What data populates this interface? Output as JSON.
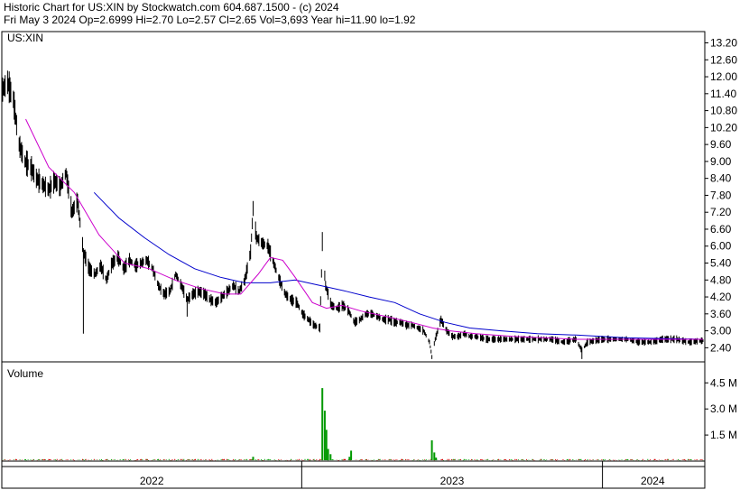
{
  "header": {
    "line1": "Historic Chart for US:XIN by Stockwatch.com 604.687.1500 - (c) 2024",
    "line2": "Fri May  3 2024   Op=2.6999  Hi=2.70  Lo=2.57  Cl=2.65  Vol=3,693  Year hi=11.90  lo=1.92"
  },
  "chart_data": {
    "type": "line",
    "ticker_label": "US:XIN",
    "volume_label": "Volume",
    "price_axis": {
      "ticks": [
        "13.20",
        "12.60",
        "12.00",
        "11.40",
        "10.80",
        "10.20",
        "9.60",
        "9.00",
        "8.40",
        "7.80",
        "7.20",
        "6.60",
        "6.00",
        "5.40",
        "4.80",
        "4.20",
        "3.60",
        "3.00",
        "2.40"
      ],
      "ylim": [
        1.9,
        13.6
      ]
    },
    "volume_axis": {
      "ticks": [
        "4.5 M",
        "3.0 M",
        "1.5 M"
      ],
      "ylim": [
        0,
        5500000
      ]
    },
    "x_axis": {
      "years": [
        "2022",
        "2023",
        "2024"
      ],
      "range": [
        "2022-01-03",
        "2024-05-03"
      ]
    },
    "colors": {
      "price": "#000000",
      "ma_short": "#cc00cc",
      "ma_long": "#0000cc",
      "vol_up": "#009900",
      "vol_down": "#cc0000"
    },
    "price_points": [
      [
        "2022-01-03",
        11.5
      ],
      [
        "2022-01-10",
        11.8
      ],
      [
        "2022-01-17",
        11.2
      ],
      [
        "2022-01-24",
        9.6
      ],
      [
        "2022-01-31",
        9.0
      ],
      [
        "2022-02-07",
        8.8
      ],
      [
        "2022-02-14",
        8.4
      ],
      [
        "2022-02-21",
        8.2
      ],
      [
        "2022-03-01",
        8.0
      ],
      [
        "2022-03-08",
        8.3
      ],
      [
        "2022-03-15",
        8.1
      ],
      [
        "2022-03-22",
        8.6
      ],
      [
        "2022-03-29",
        7.2
      ],
      [
        "2022-04-05",
        7.6
      ],
      [
        "2022-04-12",
        5.8
      ],
      [
        "2022-04-19",
        5.2
      ],
      [
        "2022-04-26",
        5.0
      ],
      [
        "2022-05-03",
        5.3
      ],
      [
        "2022-05-10",
        4.8
      ],
      [
        "2022-05-17",
        5.4
      ],
      [
        "2022-05-24",
        5.6
      ],
      [
        "2022-05-31",
        5.2
      ],
      [
        "2022-06-07",
        5.5
      ],
      [
        "2022-06-14",
        5.3
      ],
      [
        "2022-06-21",
        5.4
      ],
      [
        "2022-06-28",
        5.5
      ],
      [
        "2022-07-05",
        5.2
      ],
      [
        "2022-07-12",
        4.6
      ],
      [
        "2022-07-19",
        4.3
      ],
      [
        "2022-07-26",
        4.4
      ],
      [
        "2022-08-02",
        5.0
      ],
      [
        "2022-08-09",
        4.6
      ],
      [
        "2022-08-16",
        4.1
      ],
      [
        "2022-08-23",
        4.3
      ],
      [
        "2022-08-30",
        4.4
      ],
      [
        "2022-09-06",
        4.3
      ],
      [
        "2022-09-13",
        4.1
      ],
      [
        "2022-09-20",
        4.0
      ],
      [
        "2022-09-27",
        4.2
      ],
      [
        "2022-10-04",
        4.4
      ],
      [
        "2022-10-11",
        4.6
      ],
      [
        "2022-10-18",
        4.4
      ],
      [
        "2022-10-25",
        4.8
      ],
      [
        "2022-11-01",
        5.8
      ],
      [
        "2022-11-04",
        7.3
      ],
      [
        "2022-11-08",
        6.3
      ],
      [
        "2022-11-15",
        6.1
      ],
      [
        "2022-11-22",
        6.0
      ],
      [
        "2022-11-29",
        5.4
      ],
      [
        "2022-12-06",
        4.8
      ],
      [
        "2022-12-13",
        4.3
      ],
      [
        "2022-12-20",
        4.1
      ],
      [
        "2022-12-27",
        4.0
      ],
      [
        "2023-01-03",
        3.6
      ],
      [
        "2023-01-10",
        3.4
      ],
      [
        "2023-01-17",
        3.2
      ],
      [
        "2023-01-24",
        3.1
      ],
      [
        "2023-01-27",
        6.0
      ],
      [
        "2023-01-31",
        4.6
      ],
      [
        "2023-02-07",
        3.9
      ],
      [
        "2023-02-14",
        3.8
      ],
      [
        "2023-02-21",
        3.9
      ],
      [
        "2023-02-28",
        3.7
      ],
      [
        "2023-03-07",
        3.3
      ],
      [
        "2023-03-14",
        3.4
      ],
      [
        "2023-03-21",
        3.6
      ],
      [
        "2023-03-28",
        3.6
      ],
      [
        "2023-04-04",
        3.5
      ],
      [
        "2023-04-11",
        3.4
      ],
      [
        "2023-04-18",
        3.4
      ],
      [
        "2023-04-25",
        3.3
      ],
      [
        "2023-05-02",
        3.3
      ],
      [
        "2023-05-09",
        3.2
      ],
      [
        "2023-05-16",
        3.2
      ],
      [
        "2023-05-23",
        3.1
      ],
      [
        "2023-05-30",
        3.0
      ],
      [
        "2023-06-06",
        2.6
      ],
      [
        "2023-06-09",
        2.1
      ],
      [
        "2023-06-13",
        2.7
      ],
      [
        "2023-06-20",
        3.4
      ],
      [
        "2023-06-27",
        3.0
      ],
      [
        "2023-07-04",
        2.8
      ],
      [
        "2023-07-11",
        2.8
      ],
      [
        "2023-07-18",
        2.9
      ],
      [
        "2023-07-25",
        2.8
      ],
      [
        "2023-08-01",
        2.8
      ],
      [
        "2023-08-15",
        2.7
      ],
      [
        "2023-09-01",
        2.7
      ],
      [
        "2023-09-15",
        2.7
      ],
      [
        "2023-10-01",
        2.7
      ],
      [
        "2023-10-15",
        2.7
      ],
      [
        "2023-11-01",
        2.7
      ],
      [
        "2023-11-15",
        2.6
      ],
      [
        "2023-12-01",
        2.7
      ],
      [
        "2023-12-08",
        2.3
      ],
      [
        "2023-12-15",
        2.6
      ],
      [
        "2024-01-02",
        2.7
      ],
      [
        "2024-01-15",
        2.7
      ],
      [
        "2024-02-01",
        2.7
      ],
      [
        "2024-02-15",
        2.6
      ],
      [
        "2024-03-01",
        2.6
      ],
      [
        "2024-03-15",
        2.7
      ],
      [
        "2024-04-01",
        2.7
      ],
      [
        "2024-04-15",
        2.6
      ],
      [
        "2024-05-03",
        2.65
      ]
    ],
    "ma_short_points": [
      [
        "2022-02-01",
        10.5
      ],
      [
        "2022-03-01",
        8.8
      ],
      [
        "2022-04-01",
        7.9
      ],
      [
        "2022-05-01",
        6.4
      ],
      [
        "2022-06-01",
        5.4
      ],
      [
        "2022-07-01",
        5.2
      ],
      [
        "2022-08-01",
        4.8
      ],
      [
        "2022-09-01",
        4.5
      ],
      [
        "2022-10-01",
        4.3
      ],
      [
        "2022-10-20",
        4.3
      ],
      [
        "2022-11-10",
        5.0
      ],
      [
        "2022-11-25",
        5.6
      ],
      [
        "2022-12-10",
        5.5
      ],
      [
        "2022-12-25",
        4.9
      ],
      [
        "2023-01-15",
        4.0
      ],
      [
        "2023-02-01",
        3.8
      ],
      [
        "2023-02-20",
        3.9
      ],
      [
        "2023-03-15",
        3.7
      ],
      [
        "2023-04-15",
        3.5
      ],
      [
        "2023-05-15",
        3.3
      ],
      [
        "2023-06-10",
        3.1
      ],
      [
        "2023-07-01",
        3.0
      ],
      [
        "2023-08-01",
        2.9
      ],
      [
        "2023-09-15",
        2.8
      ],
      [
        "2023-12-01",
        2.7
      ],
      [
        "2024-02-01",
        2.7
      ],
      [
        "2024-05-03",
        2.7
      ]
    ],
    "ma_long_points": [
      [
        "2022-04-25",
        7.9
      ],
      [
        "2022-05-25",
        7.0
      ],
      [
        "2022-06-25",
        6.3
      ],
      [
        "2022-07-25",
        5.7
      ],
      [
        "2022-08-25",
        5.2
      ],
      [
        "2022-09-25",
        4.9
      ],
      [
        "2022-10-25",
        4.7
      ],
      [
        "2022-11-25",
        4.7
      ],
      [
        "2022-12-25",
        4.8
      ],
      [
        "2023-01-25",
        4.6
      ],
      [
        "2023-02-25",
        4.4
      ],
      [
        "2023-03-25",
        4.2
      ],
      [
        "2023-04-25",
        4.0
      ],
      [
        "2023-05-25",
        3.6
      ],
      [
        "2023-06-25",
        3.3
      ],
      [
        "2023-07-25",
        3.1
      ],
      [
        "2023-09-01",
        3.0
      ],
      [
        "2023-10-15",
        2.9
      ],
      [
        "2023-12-01",
        2.85
      ],
      [
        "2024-02-01",
        2.75
      ],
      [
        "2024-05-03",
        2.7
      ]
    ],
    "volume_spikes": [
      [
        "2023-01-27",
        4200000
      ],
      [
        "2023-01-30",
        2900000
      ],
      [
        "2023-02-01",
        1800000
      ],
      [
        "2023-02-03",
        700000
      ],
      [
        "2023-02-06",
        400000
      ],
      [
        "2023-03-01",
        250000
      ],
      [
        "2023-03-03",
        600000
      ],
      [
        "2023-06-09",
        1200000
      ],
      [
        "2023-06-12",
        500000
      ],
      [
        "2023-06-14",
        200000
      ],
      [
        "2022-11-04",
        250000
      ]
    ]
  }
}
